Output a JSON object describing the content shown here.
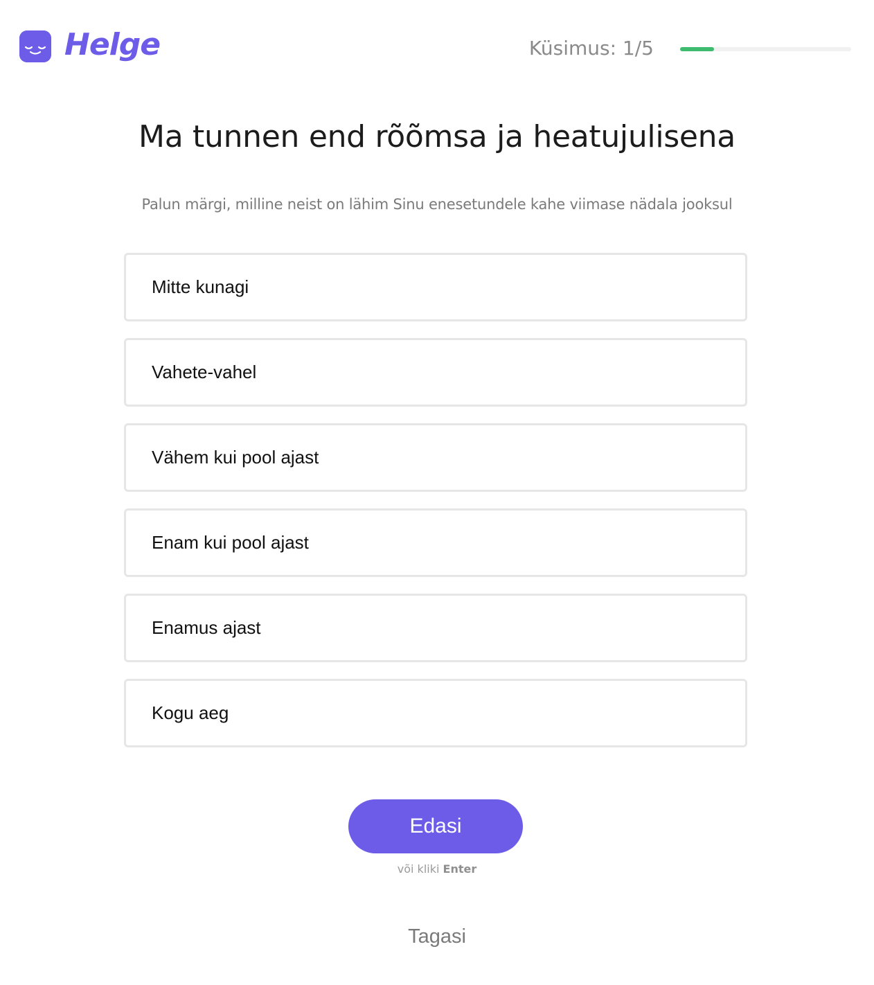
{
  "brand": {
    "name": "Helge",
    "color": "#6c5ce7",
    "icon": "sleeping-face-icon"
  },
  "progress": {
    "label": "Küsimus: 1/5",
    "current": 1,
    "total": 5,
    "fraction": 0.2,
    "color": "#3dbb6f"
  },
  "question": {
    "title": "Ma tunnen end rõõmsa ja heatujulisena",
    "instruction": "Palun märgi, milline neist on lähim Sinu enesetundele kahe viimase nädala jooksul"
  },
  "options": [
    {
      "label": "Mitte kunagi"
    },
    {
      "label": "Vahete-vahel"
    },
    {
      "label": "Vähem kui pool ajast"
    },
    {
      "label": "Enam kui pool ajast"
    },
    {
      "label": "Enamus ajast"
    },
    {
      "label": "Kogu aeg"
    }
  ],
  "actions": {
    "next_label": "Edasi",
    "hint_prefix": "või kliki",
    "hint_key": "Enter",
    "back_label": "Tagasi"
  }
}
